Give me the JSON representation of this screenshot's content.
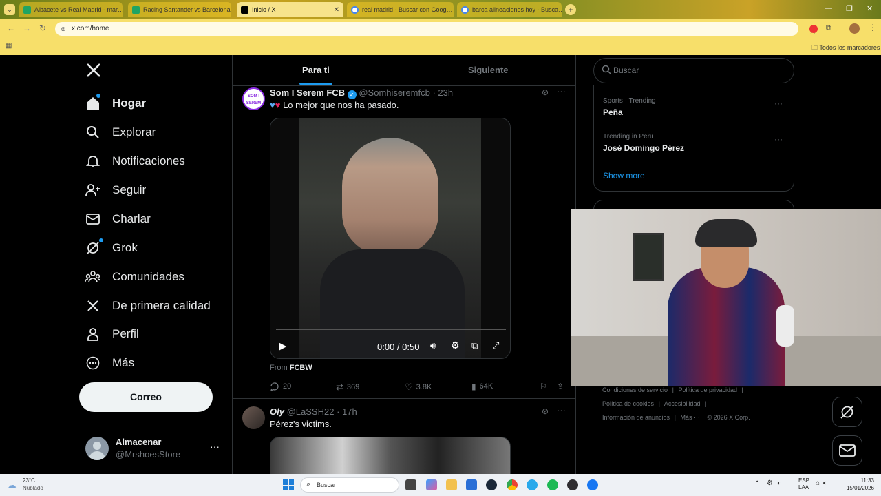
{
  "browser": {
    "tabs": [
      {
        "title": "Albacete vs Real Madrid - mar…",
        "color": "#1fa463"
      },
      {
        "title": "Racing Santander vs Barcelona…",
        "color": "#1fa463"
      },
      {
        "title": "Inicio / X",
        "color": "#000000"
      },
      {
        "title": "real madrid - Buscar con Goog…",
        "color": "#4285f4"
      },
      {
        "title": "barca alineaciones hoy - Busca…",
        "color": "#4285f4"
      }
    ],
    "url": "x.com/home",
    "bookmarks_label": "Todos los marcadores"
  },
  "nav": {
    "items": [
      {
        "label": "Hogar",
        "icon": "home-icon"
      },
      {
        "label": "Explorar",
        "icon": "search-icon"
      },
      {
        "label": "Notificaciones",
        "icon": "bell-icon"
      },
      {
        "label": "Seguir",
        "icon": "follow-icon"
      },
      {
        "label": "Charlar",
        "icon": "mail-icon"
      },
      {
        "label": "Grok",
        "icon": "grok-icon"
      },
      {
        "label": "Comunidades",
        "icon": "communities-icon"
      },
      {
        "label": "De primera calidad",
        "icon": "x-logo-icon"
      },
      {
        "label": "Perfil",
        "icon": "profile-icon"
      },
      {
        "label": "Más",
        "icon": "more-icon"
      }
    ],
    "post_button": "Correo",
    "account": {
      "name": "Almacenar",
      "handle": "@MrshoesStore"
    }
  },
  "feed": {
    "tabs": [
      "Para ti",
      "Siguiente"
    ],
    "post1": {
      "author": "Som I Serem FCB",
      "handle": "@Somhiseremfcb",
      "time": "· 23h",
      "text": "Lo mejor que nos ha pasado.",
      "video_time": "0:00 / 0:50",
      "from_label": "From",
      "from_source": "FCBW",
      "replies": "20",
      "reposts": "369",
      "likes": "3.8K",
      "views": "64K"
    },
    "post2": {
      "author": "Oly",
      "handle": "@LaSSH22",
      "time": "· 17h",
      "text": "Pérez's victims."
    }
  },
  "sidebar": {
    "search_placeholder": "Buscar",
    "trends": [
      {
        "context": "Sports · Trending",
        "name": "Peña"
      },
      {
        "context": "Trending in Peru",
        "name": "José Domingo Pérez"
      }
    ],
    "show_more": "Show more",
    "footer": [
      "Condiciones de servicio",
      "|",
      "Política de privacidad",
      "|",
      "Política de cookies",
      "|",
      "Accesibilidad",
      "|",
      "Información de anuncios",
      "|",
      "Más ···",
      "© 2026 X Corp."
    ]
  },
  "taskbar": {
    "weather_temp": "23°C",
    "weather_desc": "Nublado",
    "search": "Buscar",
    "lang": "ESP",
    "lang2": "LAA",
    "time": "11:33",
    "date": "15/01/2026"
  },
  "colors": {
    "accent": "#1d9bf0",
    "verified": "#1d9bf0"
  }
}
